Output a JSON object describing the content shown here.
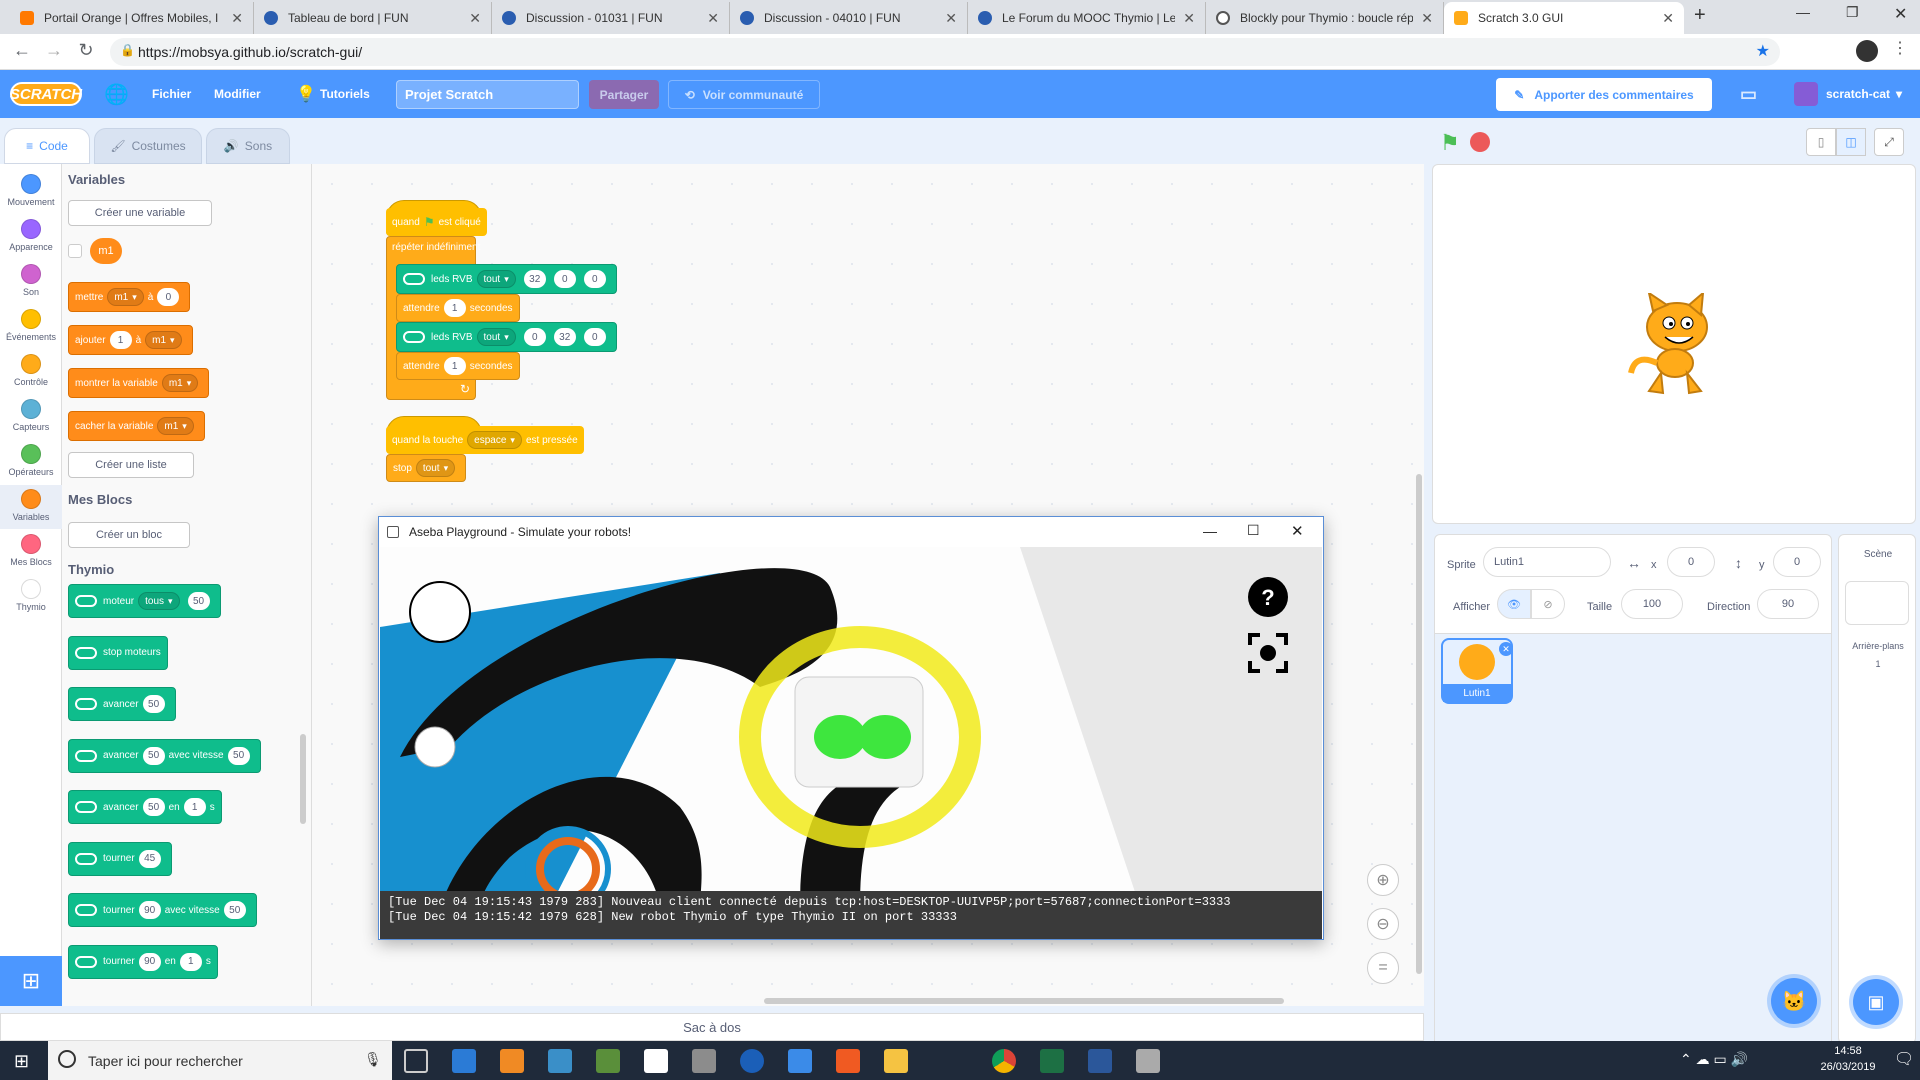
{
  "browser": {
    "tabs": [
      {
        "title": "Portail Orange | Offres Mobiles, I",
        "color": "#ff7900"
      },
      {
        "title": "Tableau de bord | FUN",
        "color": "#2a5db0"
      },
      {
        "title": "Discussion - 01031 | FUN",
        "color": "#2a5db0"
      },
      {
        "title": "Discussion - 04010 | FUN",
        "color": "#2a5db0"
      },
      {
        "title": "Le Forum du MOOC Thymio | Le",
        "color": "#2a5db0"
      },
      {
        "title": "Blockly pour Thymio : boucle rép",
        "color": "#555"
      },
      {
        "title": "Scratch 3.0 GUI",
        "color": "#ffab19"
      }
    ],
    "url": "https://mobsya.github.io/scratch-gui/"
  },
  "menubar": {
    "logo": "SCRATCH",
    "file": "Fichier",
    "edit": "Modifier",
    "tutorials": "Tutoriels",
    "project_title": "Projet Scratch",
    "share": "Partager",
    "community": "Voir communauté",
    "feedback": "Apporter des commentaires",
    "user": "scratch-cat"
  },
  "editor_tabs": {
    "code": "Code",
    "costumes": "Costumes",
    "sounds": "Sons"
  },
  "categories": [
    {
      "label": "Mouvement",
      "color": "#4c97ff"
    },
    {
      "label": "Apparence",
      "color": "#9966ff"
    },
    {
      "label": "Son",
      "color": "#cf63cf"
    },
    {
      "label": "Événements",
      "color": "#ffbf00"
    },
    {
      "label": "Contrôle",
      "color": "#ffab19"
    },
    {
      "label": "Capteurs",
      "color": "#5cb1d6"
    },
    {
      "label": "Opérateurs",
      "color": "#59c059"
    },
    {
      "label": "Variables",
      "color": "#ff8c1a"
    },
    {
      "label": "Mes Blocs",
      "color": "#ff6680"
    },
    {
      "label": "Thymio",
      "color": "#ffffff"
    }
  ],
  "palette": {
    "variables_header": "Variables",
    "create_variable": "Créer une variable",
    "var_name": "m1",
    "set_block": {
      "a": "mettre",
      "var": "m1",
      "b": "à",
      "val": "0"
    },
    "change_block": {
      "a": "ajouter",
      "val": "1",
      "b": "à",
      "var": "m1"
    },
    "show_block": {
      "a": "montrer la variable",
      "var": "m1"
    },
    "hide_block": {
      "a": "cacher la variable",
      "var": "m1"
    },
    "create_list": "Créer une liste",
    "myblocks_header": "Mes Blocs",
    "create_block": "Créer un bloc",
    "thymio_header": "Thymio",
    "thymio_blocks": [
      {
        "parts": [
          "moteur"
        ],
        "dd": "tous",
        "vals": [
          "50"
        ]
      },
      {
        "parts": [
          "stop moteurs"
        ]
      },
      {
        "parts": [
          "avancer"
        ],
        "vals": [
          "50"
        ]
      },
      {
        "parts": [
          "avancer",
          "avec vitesse"
        ],
        "vals": [
          "50",
          "50"
        ]
      },
      {
        "parts": [
          "avancer",
          "en",
          "s"
        ],
        "vals": [
          "50",
          "1"
        ]
      },
      {
        "parts": [
          "tourner"
        ],
        "vals": [
          "45"
        ]
      },
      {
        "parts": [
          "tourner",
          "avec vitesse"
        ],
        "vals": [
          "90",
          "50"
        ]
      },
      {
        "parts": [
          "tourner",
          "en",
          "s"
        ],
        "vals": [
          "90",
          "1"
        ]
      }
    ]
  },
  "script1": {
    "hat": {
      "a": "quand",
      "b": "est cliqué"
    },
    "forever": "répéter indéfiniment",
    "leds1": {
      "label": "leds RVB",
      "dd": "tout",
      "r": "32",
      "g": "0",
      "b": "0"
    },
    "wait1": {
      "a": "attendre",
      "val": "1",
      "b": "secondes"
    },
    "leds2": {
      "label": "leds RVB",
      "dd": "tout",
      "r": "0",
      "g": "32",
      "b": "0"
    },
    "wait2": {
      "a": "attendre",
      "val": "1",
      "b": "secondes"
    }
  },
  "script2": {
    "hat": {
      "a": "quand la touche",
      "dd": "espace",
      "b": "est pressée"
    },
    "stop": {
      "a": "stop",
      "dd": "tout"
    }
  },
  "aseba": {
    "title": "Aseba Playground - Simulate your robots!",
    "log1": "[Tue Dec 04 19:15:43 1979 283] Nouveau client connecté depuis tcp:host=DESKTOP-UUIVP5P;port=57687;connectionPort=3333",
    "log2": "[Tue Dec 04 19:15:42 1979 628] New robot Thymio of type Thymio II on port 33333"
  },
  "backpack": "Sac à dos",
  "sprite_info": {
    "sprite_label": "Sprite",
    "sprite_name": "Lutin1",
    "x_label": "x",
    "x": "0",
    "y_label": "y",
    "y": "0",
    "show_label": "Afficher",
    "size_label": "Taille",
    "size": "100",
    "direction_label": "Direction",
    "direction": "90"
  },
  "sprites": [
    {
      "name": "Lutin1"
    }
  ],
  "stage_panel": {
    "title": "Scène",
    "backdrops_label": "Arrière-plans",
    "backdrops_count": "1"
  },
  "taskbar": {
    "search_placeholder": "Taper ici pour rechercher",
    "time": "14:58",
    "date": "26/03/2019"
  }
}
